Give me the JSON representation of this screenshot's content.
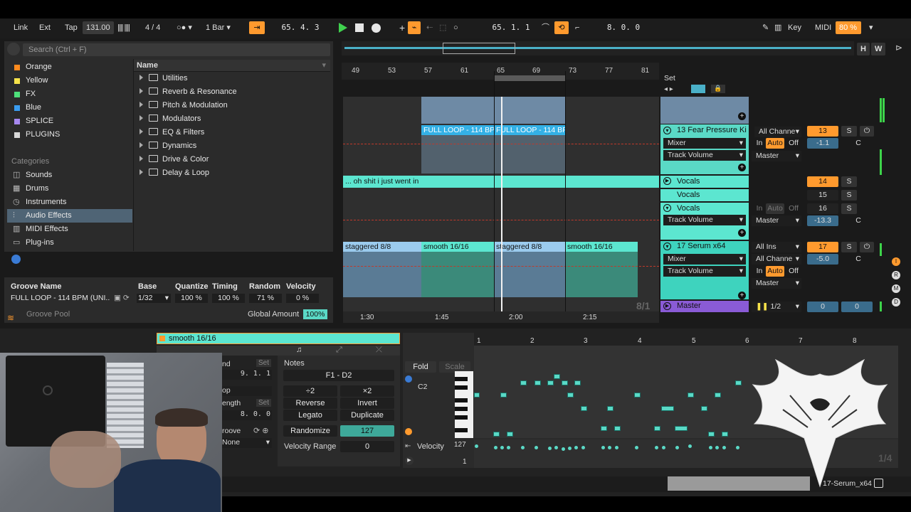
{
  "toolbar": {
    "link": "Link",
    "ext": "Ext",
    "tap": "Tap",
    "tempo": "131.00",
    "signature": "4 / 4",
    "quantize": "1 Bar",
    "arrangement_position": "65.  4.  3",
    "loop_start": "65.  1.  1",
    "loop_length": "8.  0.  0",
    "key": "Key",
    "midi": "MIDI",
    "cpu": "80 %"
  },
  "browser": {
    "search_placeholder": "Search (Ctrl + F)",
    "collections": [
      {
        "label": "Orange",
        "color": "#ff8a1e"
      },
      {
        "label": "Yellow",
        "color": "#f7e34a"
      },
      {
        "label": "FX",
        "color": "#4ee07a"
      },
      {
        "label": "Blue",
        "color": "#3a9cf0"
      },
      {
        "label": "SPLICE",
        "color": "#a788f0"
      },
      {
        "label": "PLUGINS",
        "color": "#d8d8d8"
      }
    ],
    "categories_title": "Categories",
    "categories": [
      "Sounds",
      "Drums",
      "Instruments",
      "Audio Effects",
      "MIDI Effects",
      "Plug-ins"
    ],
    "name_header": "Name",
    "items": [
      "Utilities",
      "Reverb & Resonance",
      "Pitch & Modulation",
      "Modulators",
      "EQ & Filters",
      "Dynamics",
      "Drive & Color",
      "Delay & Loop"
    ]
  },
  "groove": {
    "headers": [
      "Groove Name",
      "Base",
      "Quantize",
      "Timing",
      "Random",
      "Velocity"
    ],
    "name": "FULL LOOP - 114 BPM (UNI...",
    "base": "1/32",
    "quantize": "100 %",
    "timing": "100 %",
    "random": "71 %",
    "velocity": "0 %",
    "pool": "Groove Pool",
    "global_label": "Global Amount",
    "global_value": "100%"
  },
  "arrangement": {
    "bars": [
      "49",
      "53",
      "57",
      "61",
      "65",
      "69",
      "73",
      "77",
      "81"
    ],
    "times": [
      "1:30",
      "1:45",
      "2:00",
      "2:15"
    ],
    "set": "Set",
    "zoom": "8/1",
    "clips": {
      "full_loop_a": "FULL LOOP - 114 BPM",
      "full_loop_b": "FULL LOOP - 114 BPM",
      "vocal": "... oh shit i just went in",
      "stag_a": "staggered 8/8",
      "smooth_a": "smooth 16/16",
      "stag_b": "staggered 8/8",
      "smooth_b": "smooth 16/16"
    }
  },
  "mixer": {
    "track13": {
      "name": "13 Fear Pressure Ki",
      "input": "All Channe",
      "num": "13",
      "vol": "-1.1",
      "dev": "Mixer",
      "param": "Track Volume",
      "out": "Master"
    },
    "vocals1": {
      "name": "Vocals",
      "num": "14"
    },
    "vocals2": {
      "name": "Vocals",
      "num": "15"
    },
    "vocals3": {
      "name": "Vocals",
      "num": "16",
      "param": "Track Volume",
      "out": "Master",
      "vol": "-13.3"
    },
    "track17": {
      "name": "17 Serum  x64",
      "input": "All Ins",
      "channel": "All Channe",
      "num": "17",
      "vol": "-5.0",
      "dev": "Mixer",
      "param": "Track Volume",
      "out": "Master"
    },
    "master": {
      "name": "Master",
      "quant": "1/2",
      "a": "0",
      "b": "0"
    },
    "in": "In",
    "auto": "Auto",
    "off": "Off",
    "s": "S",
    "c": "C"
  },
  "clip_view": {
    "clip_name": "smooth 16/16",
    "end_label": "nd",
    "end_value": "9.  1.  1",
    "set": "Set",
    "loop_label": "op",
    "length_label": "ength",
    "length_value": "8.  0.  0",
    "groove_label": "roove",
    "groove_value": "None",
    "notes_title": "Notes",
    "range": "F1 - D2",
    "half": "÷2",
    "double": "×2",
    "reverse": "Reverse",
    "invert": "Invert",
    "legato": "Legato",
    "duplicate": "Duplicate",
    "randomize": "Randomize",
    "rand_value": "127",
    "vel_range_label": "Velocity Range",
    "vel_range": "0"
  },
  "piano_roll": {
    "fold": "Fold",
    "scale": "Scale",
    "c2": "C2",
    "bars": [
      "1",
      "2",
      "3",
      "4",
      "5",
      "6",
      "7",
      "8"
    ],
    "velocity": "Velocity",
    "v_max": "127",
    "v_min": "1",
    "zoom": "1/4",
    "device": "17-Serum_x64"
  }
}
